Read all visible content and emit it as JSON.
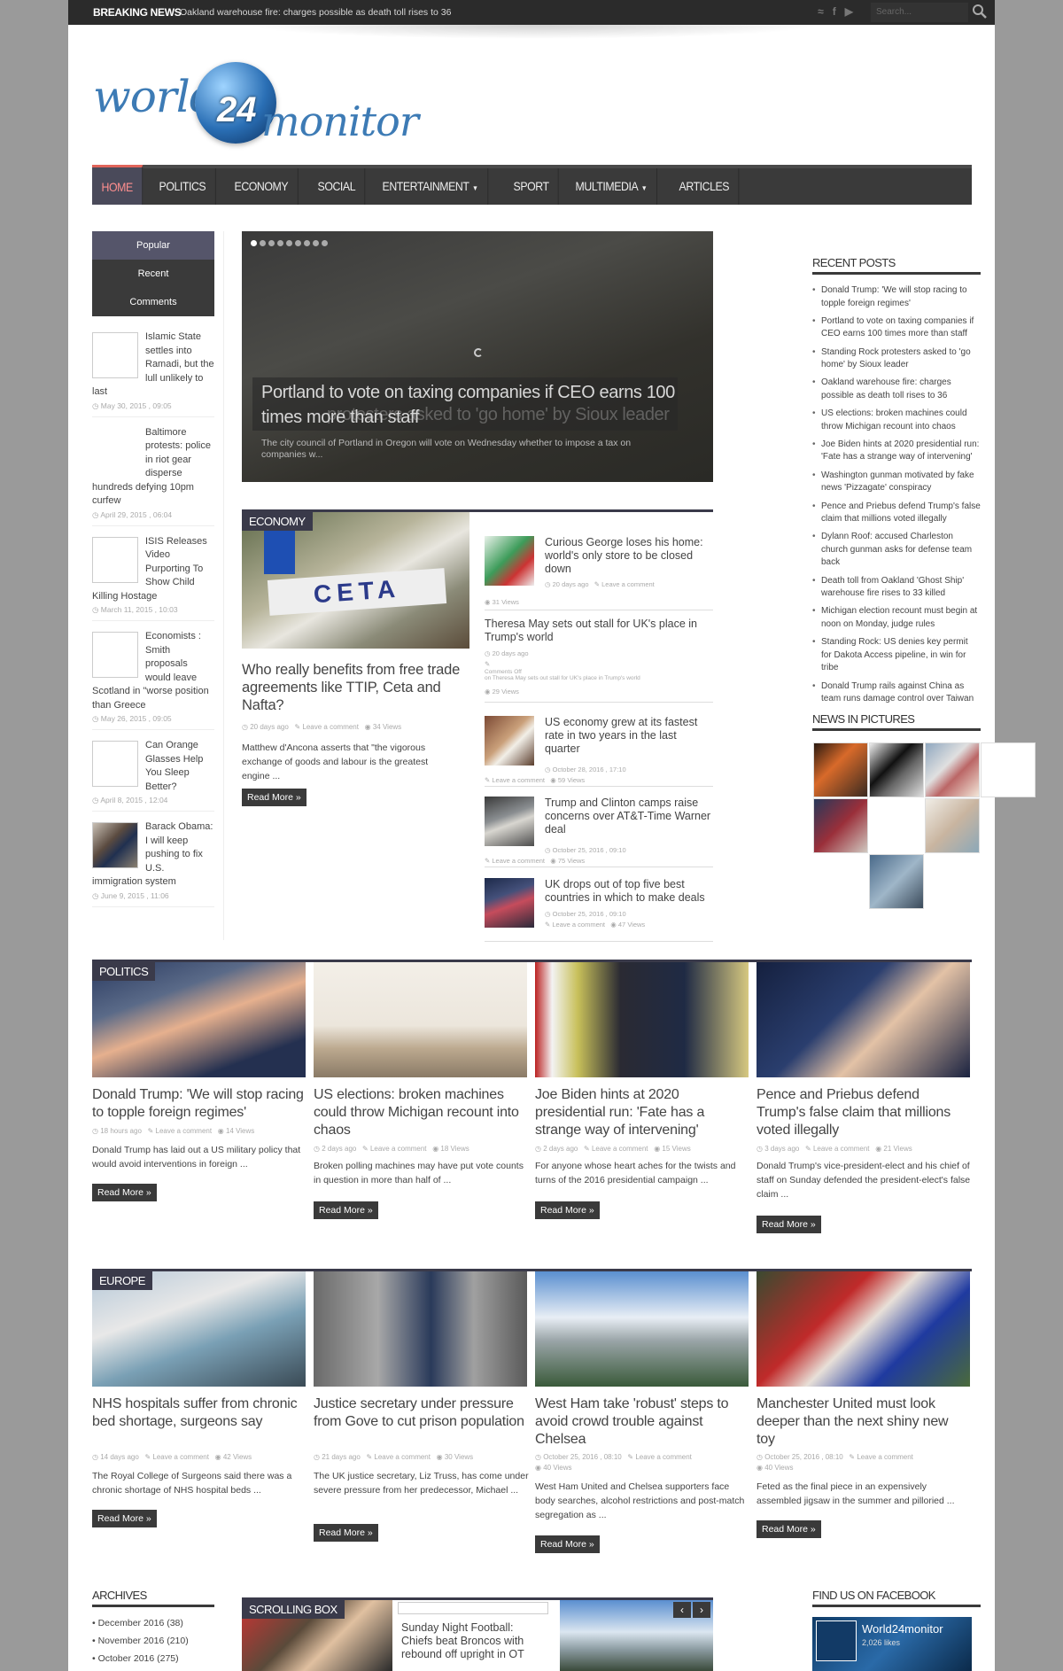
{
  "breaking": {
    "label": "BREAKING NEWS",
    "text": "Oakland warehouse fire: charges possible as death toll rises to 36",
    "search_placeholder": "Search..."
  },
  "social_icons": [
    "rss-icon",
    "facebook-icon",
    "youtube-icon"
  ],
  "logo": {
    "part1": "world",
    "num": "24",
    "part2": "monitor"
  },
  "nav": {
    "items": [
      {
        "label": "HOME",
        "active": true
      },
      {
        "label": "POLITICS"
      },
      {
        "label": "ECONOMY"
      },
      {
        "label": "SOCIAL"
      },
      {
        "label": "ENTERTAINMENT",
        "caret": true
      },
      {
        "label": "SPORT"
      },
      {
        "label": "MULTIMEDIA",
        "caret": true
      },
      {
        "label": "ARTICLES"
      }
    ]
  },
  "tabs": {
    "popular": "Popular",
    "recent": "Recent",
    "comments": "Comments"
  },
  "side_items": [
    {
      "title": "Islamic State settles into Ramadi, but the lull unlikely to last",
      "date": "May 30, 2015 , 09:05"
    },
    {
      "title": "Baltimore protests: police in riot gear disperse hundreds defying 10pm curfew",
      "date": "April 29, 2015 , 06:04"
    },
    {
      "title": "ISIS Releases Video Purporting To Show Child Killing Hostage",
      "date": "March 11, 2015 , 10:03"
    },
    {
      "title": "Economists : Smith proposals would leave Scotland in \"worse position than Greece",
      "date": "May 26, 2015 , 09:05"
    },
    {
      "title": "Can Orange Glasses Help You Sleep Better?",
      "date": "April 8, 2015 , 12:04"
    },
    {
      "title": "Barack Obama: I will keep pushing to fix U.S. immigration system",
      "date": "June 9, 2015 , 11:06"
    }
  ],
  "slider": {
    "title": "Portland to vote on taxing companies if CEO earns 100 times more than staff",
    "ghost_title": "protesters asked to 'go home' by Sioux leader",
    "text": "The city council of Portland in Oregon will vote on Wednesday whether to impose a tax on companies w..."
  },
  "economy": {
    "label": "ECONOMY",
    "main": {
      "title": "Who really benefits from free trade agreements like TTIP, Ceta and Nafta?",
      "time": "20 days ago",
      "comment": "Leave a comment",
      "views": "34 Views",
      "excerpt": "Matthew d'Ancona asserts that \"the vigorous exchange of goods and labour is the greatest engine ...",
      "read_more": "Read More »",
      "banner": "CETA"
    },
    "list": [
      {
        "title": "Curious George loses his home: world's only store to be closed down",
        "time": "20 days ago",
        "comment": "Leave a comment",
        "views": "31 Views"
      },
      {
        "title": "Theresa May sets out stall for UK's place in Trump's world",
        "time": "20 days ago",
        "comments_off": "Comments Off",
        "comments_off_on": "on Theresa May sets out stall for UK's place in Trump's world",
        "views": "29 Views"
      },
      {
        "title": "US economy grew at its fastest rate in two years in the last quarter",
        "time": "October 28, 2016 , 17:10",
        "comment": "Leave a comment",
        "views": "59 Views"
      },
      {
        "title": "Trump and Clinton camps raise concerns over AT&T-Time Warner deal",
        "time": "October 25, 2016 , 09:10",
        "comment": "Leave a comment",
        "views": "75 Views"
      },
      {
        "title": "UK drops out of top five best countries in which to make deals",
        "time": "October 25, 2016 , 09:10",
        "comment": "Leave a comment",
        "views": "47 Views"
      }
    ]
  },
  "recent_posts": {
    "heading": "RECENT POSTS",
    "items": [
      "Donald Trump: 'We will stop racing to topple foreign regimes'",
      "Portland to vote on taxing companies if CEO earns 100 times more than staff",
      "Standing Rock protesters asked to 'go home' by Sioux leader",
      "Oakland warehouse fire: charges possible as death toll rises to 36",
      "US elections: broken machines could throw Michigan recount into chaos",
      "Joe Biden hints at 2020 presidential run: 'Fate has a strange way of intervening'",
      "Washington gunman motivated by fake news 'Pizzagate' conspiracy",
      "Pence and Priebus defend Trump's false claim that millions voted illegally",
      "Dylann Roof: accused Charleston church gunman asks for defense team back",
      "Death toll from Oakland 'Ghost Ship' warehouse fire rises to 33 killed",
      "Michigan election recount must begin at noon on Monday, judge rules",
      "Standing Rock: US denies key permit for Dakota Access pipeline, in win for tribe",
      "Donald Trump rails against China as team runs damage control over Taiwan"
    ]
  },
  "news_pictures": {
    "heading": "NEWS IN PICTURES"
  },
  "politics": {
    "label": "POLITICS",
    "cards": [
      {
        "title": "Donald Trump: 'We will stop racing to topple foreign regimes'",
        "time": "18 hours ago",
        "comment": "Leave a comment",
        "views": "14 Views",
        "excerpt": "Donald Trump has laid out a US military policy that would avoid interventions in foreign ...",
        "read_more": "Read More »"
      },
      {
        "title": "US elections: broken machines could throw Michigan recount into chaos",
        "time": "2 days ago",
        "comment": "Leave a comment",
        "views": "18 Views",
        "excerpt": "Broken polling machines may have put vote counts in question in more than half of ...",
        "read_more": "Read More »"
      },
      {
        "title": "Joe Biden hints at 2020 presidential run: 'Fate has a strange way of intervening'",
        "time": "2 days ago",
        "comment": "Leave a comment",
        "views": "15 Views",
        "excerpt": "For anyone whose heart aches for the twists and turns of the 2016 presidential campaign ...",
        "read_more": "Read More »"
      },
      {
        "title": "Pence and Priebus defend Trump's false claim that millions voted illegally",
        "time": "3 days ago",
        "comment": "Leave a comment",
        "views": "21 Views",
        "excerpt": "Donald Trump's vice-president-elect and his chief of staff on Sunday defended the president-elect's false claim ...",
        "read_more": "Read More »"
      }
    ]
  },
  "europe": {
    "label": "EUROPE",
    "cards": [
      {
        "title": "NHS hospitals suffer from chronic bed shortage, surgeons say",
        "time": "14 days ago",
        "comment": "Leave a comment",
        "views": "42 Views",
        "excerpt": "The Royal College of Surgeons said there was a chronic shortage of NHS hospital beds ...",
        "read_more": "Read More »"
      },
      {
        "title": "Justice secretary under pressure from Gove to cut prison population",
        "time": "21 days ago",
        "comment": "Leave a comment",
        "views": "30 Views",
        "excerpt": "The UK justice secretary, Liz Truss, has come under severe pressure from her predecessor, Michael ...",
        "read_more": "Read More »"
      },
      {
        "title": "West Ham take 'robust' steps to avoid crowd trouble against Chelsea",
        "time": "October 25, 2016 , 08:10",
        "comment": "Leave a comment",
        "views": "40 Views",
        "excerpt": "West Ham United and Chelsea supporters face body searches, alcohol restrictions and post-match segregation as ...",
        "read_more": "Read More »"
      },
      {
        "title": "Manchester United must look deeper than the next shiny new toy",
        "time": "October 25, 2016 , 08:10",
        "comment": "Leave a comment",
        "views": "40 Views",
        "excerpt": "Feted as the final piece in an expensively assembled jigsaw in the summer and pilloried ...",
        "read_more": "Read More »"
      }
    ]
  },
  "archives": {
    "heading": "ARCHIVES",
    "items": [
      "December 2016 (38)",
      "November 2016 (210)",
      "October 2016 (275)"
    ]
  },
  "scrolling_box": {
    "label": "SCROLLING BOX",
    "title": "Sunday Night Football: Chiefs beat Broncos with rebound off upright in OT"
  },
  "facebook": {
    "heading": "FIND US ON FACEBOOK",
    "name": "World24monitor",
    "likes": "2,026 likes"
  }
}
